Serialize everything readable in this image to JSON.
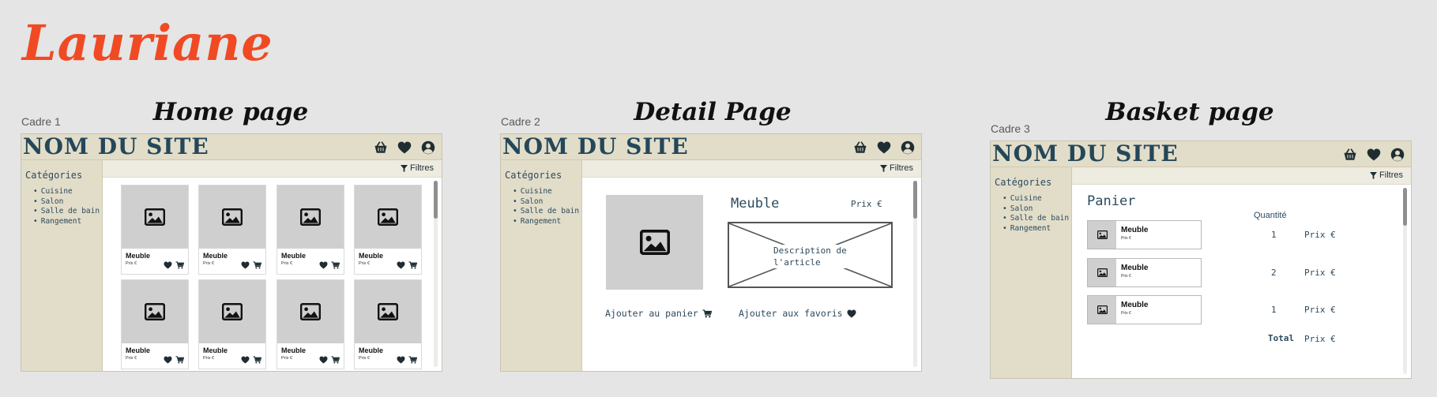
{
  "brand": "Lauriane",
  "pages": {
    "home": {
      "heading": "Home page",
      "frame_label": "Cadre 1"
    },
    "detail": {
      "heading": "Detail Page",
      "frame_label": "Cadre 2"
    },
    "basket": {
      "heading": "Basket page",
      "frame_label": "Cadre 3"
    }
  },
  "site": {
    "name": "NOM DU SITE",
    "header_icons": [
      "basket-icon",
      "heart-icon",
      "user-circle-icon"
    ],
    "filter_label": "Filtres",
    "filter_icon": "filter-icon",
    "categories_title": "Catégories",
    "categories": [
      "Cuisine",
      "Salon",
      "Salle de bain",
      "Rangement"
    ]
  },
  "product_card": {
    "name": "Meuble",
    "price": "Prix €",
    "image_icon": "image-icon",
    "action_icons": [
      "heart-icon",
      "cart-icon"
    ]
  },
  "product_grid_count": 8,
  "detail": {
    "title": "Meuble",
    "price": "Prix €",
    "description": "Description de l'article",
    "add_to_cart": "Ajouter au panier",
    "add_to_favorites": "Ajouter aux favoris"
  },
  "basket": {
    "title": "Panier",
    "quantity_header": "Quantité",
    "items": [
      {
        "name": "Meuble",
        "price": "Prix €",
        "quantity": "1",
        "line_price": "Prix €"
      },
      {
        "name": "Meuble",
        "price": "Prix €",
        "quantity": "2",
        "line_price": "Prix €"
      },
      {
        "name": "Meuble",
        "price": "Prix €",
        "quantity": "1",
        "line_price": "Prix €"
      }
    ],
    "total_label": "Total",
    "total_value": "Prix €"
  },
  "colors": {
    "brand": "#f04a24",
    "site_name": "#24475a",
    "header_bg": "#e2ddc9",
    "filter_bg": "#eeece0",
    "placeholder": "#cfcfcf",
    "background": "#e5e5e5"
  }
}
